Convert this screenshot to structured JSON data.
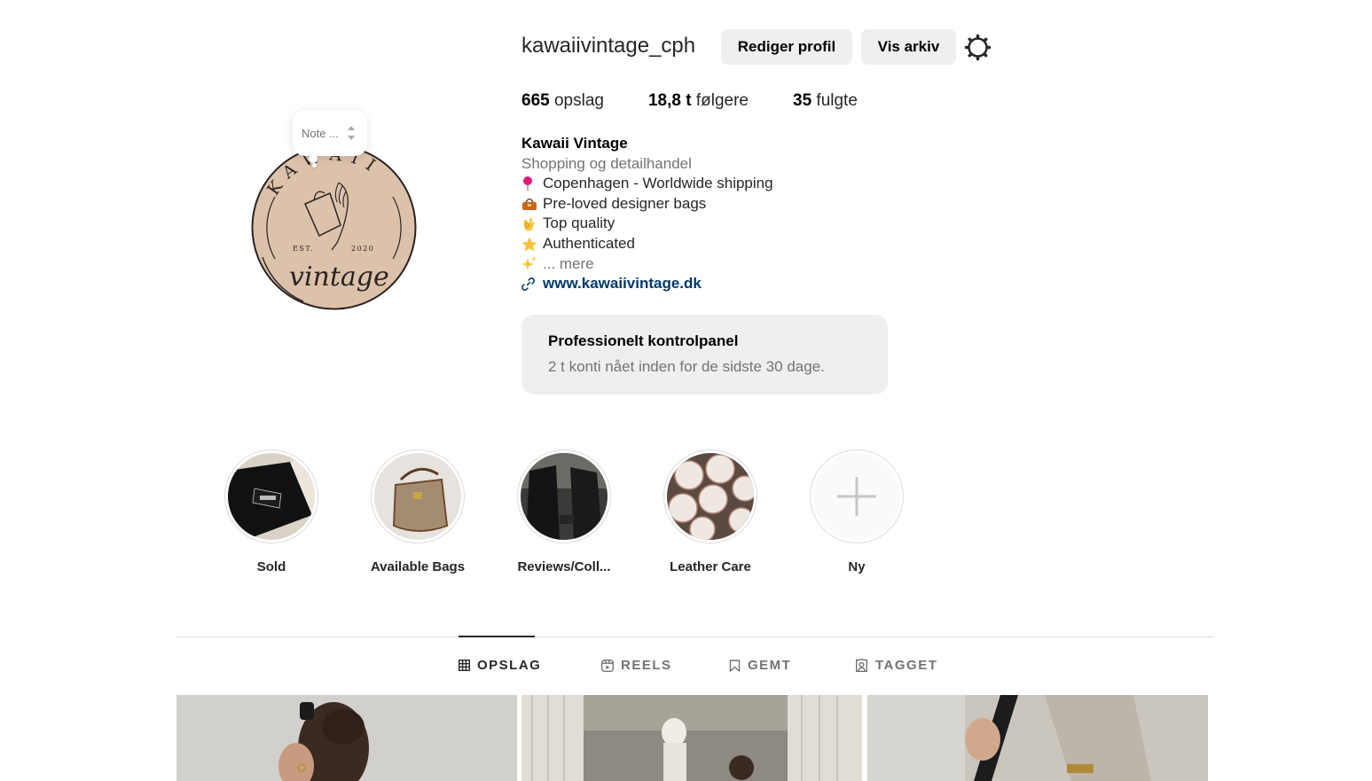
{
  "profile": {
    "username": "kawaiivintage_cph",
    "edit_button": "Rediger profil",
    "archive_button": "Vis arkiv",
    "note_placeholder": "Note ...",
    "avatar_logo": {
      "top_text": "KAWAII",
      "est_text": "EST.",
      "year_text": "2020",
      "script_text": "vintage"
    }
  },
  "stats": {
    "posts_count": "665",
    "posts_label": "opslag",
    "followers_count": "18,8 t",
    "followers_label": "følgere",
    "following_count": "35",
    "following_label": "fulgte"
  },
  "bio": {
    "name": "Kawaii Vintage",
    "category": "Shopping og detailhandel",
    "lines": [
      {
        "icon": "📍",
        "text": "Copenhagen - Worldwide shipping"
      },
      {
        "icon": "👜",
        "text": "Pre-loved designer bags"
      },
      {
        "icon": "👌",
        "text": "Top quality"
      },
      {
        "icon": "⭐",
        "text": "Authenticated"
      }
    ],
    "more_icon": "✨",
    "more_text": "... mere",
    "link": "www.kawaiivintage.dk"
  },
  "dashboard": {
    "title": "Professionelt kontrolpanel",
    "subtitle": "2 t konti nået inden for de sidste 30 dage."
  },
  "highlights": [
    {
      "label": "Sold"
    },
    {
      "label": "Available Bags"
    },
    {
      "label": "Reviews/Coll..."
    },
    {
      "label": "Leather Care"
    },
    {
      "label": "Ny"
    }
  ],
  "tabs": [
    {
      "label": "OPSLAG",
      "active": true
    },
    {
      "label": "REELS",
      "active": false
    },
    {
      "label": "GEMT",
      "active": false
    },
    {
      "label": "TAGGET",
      "active": false
    }
  ],
  "colors": {
    "logo_beige": "#dcc2ab",
    "logo_dark": "#2b2220",
    "link_blue": "#00376b",
    "button_bg": "#efefef"
  }
}
